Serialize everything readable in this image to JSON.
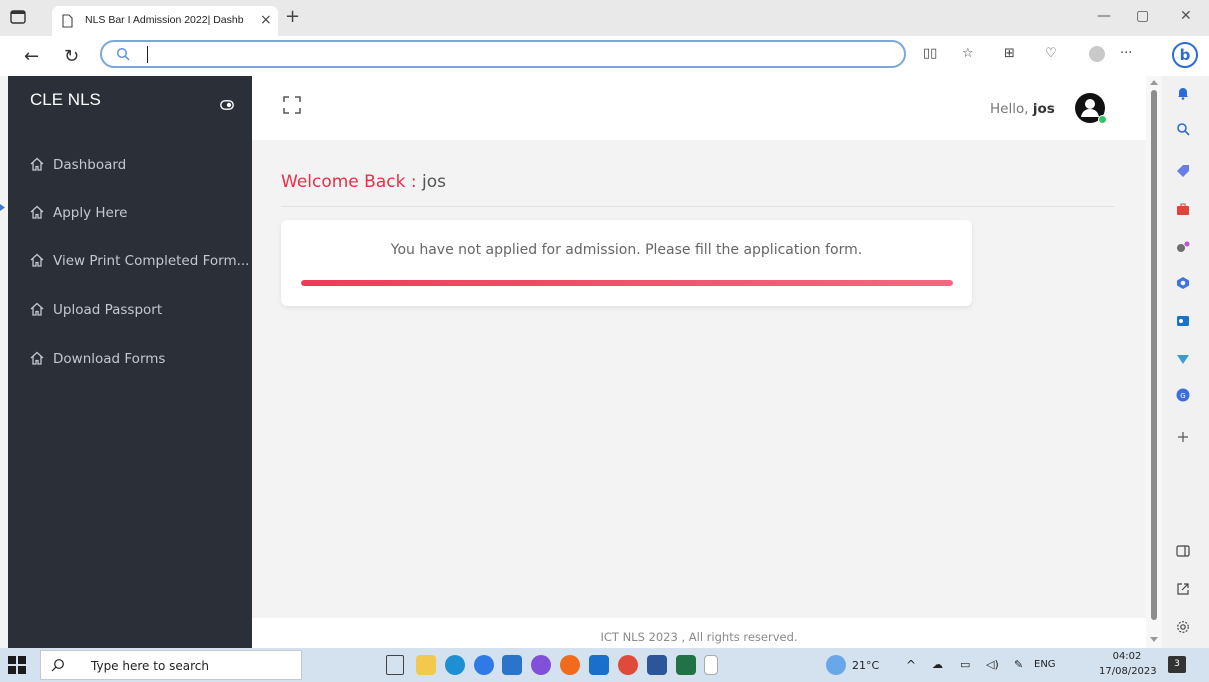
{
  "browser": {
    "tab_title": "NLS Bar I Admission 2022| Dashb",
    "tab_close": "×",
    "new_tab": "+",
    "window_controls": [
      "—",
      "▢",
      "✕"
    ],
    "address_value": "",
    "more_label": "···",
    "bing_label": "b"
  },
  "app": {
    "brand": "CLE NLS",
    "menu": [
      {
        "label": "Dashboard",
        "icon": "home-icon"
      },
      {
        "label": "Apply Here",
        "icon": "home-icon"
      },
      {
        "label": "View Print Completed Form...",
        "icon": "home-icon"
      },
      {
        "label": "Upload Passport",
        "icon": "home-icon"
      },
      {
        "label": "Download Forms",
        "icon": "home-icon"
      }
    ],
    "greeting": "Hello,",
    "username": "jos",
    "welcome_label": "Welcome Back :",
    "welcome_user": "jos",
    "notice": "You have not applied for admission. Please fill the application form.",
    "progress_percent": 100,
    "accent": "#ef2d4a",
    "footer": "ICT NLS 2023 , All rights reserved."
  },
  "taskbar": {
    "search_placeholder": "Type here to search",
    "temperature": "21°C",
    "language": "ENG",
    "time": "04:02",
    "date": "17/08/2023",
    "notifications": "3"
  }
}
